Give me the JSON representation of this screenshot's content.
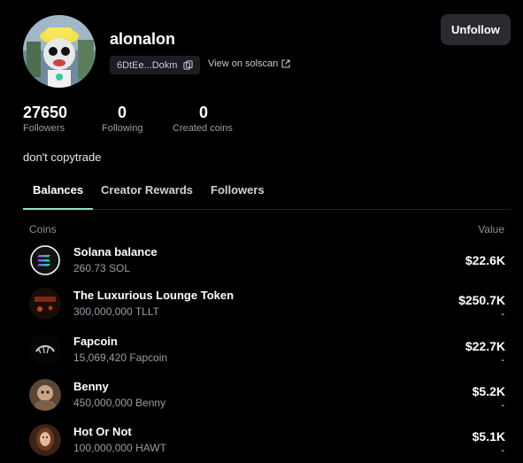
{
  "profile": {
    "username": "alonalon",
    "address_short": "6DtEe...Dokm",
    "solscan_label": "View on solscan",
    "follow_button": "Unfollow",
    "bio": "don't copytrade"
  },
  "stats": [
    {
      "value": "27650",
      "label": "Followers"
    },
    {
      "value": "0",
      "label": "Following"
    },
    {
      "value": "0",
      "label": "Created coins"
    }
  ],
  "tabs": [
    {
      "label": "Balances",
      "active": true
    },
    {
      "label": "Creator Rewards",
      "active": false
    },
    {
      "label": "Followers",
      "active": false
    }
  ],
  "table": {
    "col_coins": "Coins",
    "col_value": "Value",
    "rows": [
      {
        "name": "Solana balance",
        "amount": "260.73 SOL",
        "value": "$22.6K",
        "change": "",
        "icon": "solana-icon"
      },
      {
        "name": "The Luxurious Lounge Token",
        "amount": "300,000,000 TLLT",
        "value": "$250.7K",
        "change": "-",
        "icon": "tllt-icon"
      },
      {
        "name": "Fapcoin",
        "amount": "15,069,420 Fapcoin",
        "value": "$22.7K",
        "change": "-",
        "icon": "fapcoin-icon"
      },
      {
        "name": "Benny",
        "amount": "450,000,000 Benny",
        "value": "$5.2K",
        "change": "-",
        "icon": "benny-icon"
      },
      {
        "name": "Hot Or Not",
        "amount": "100,000,000 HAWT",
        "value": "$5.1K",
        "change": "-",
        "icon": "hawt-icon"
      }
    ]
  },
  "colors": {
    "background": "#000000",
    "active_tab_underline": "#8fe3c4",
    "button_bg": "#2a2b30",
    "muted_text": "#9b9ca3"
  }
}
